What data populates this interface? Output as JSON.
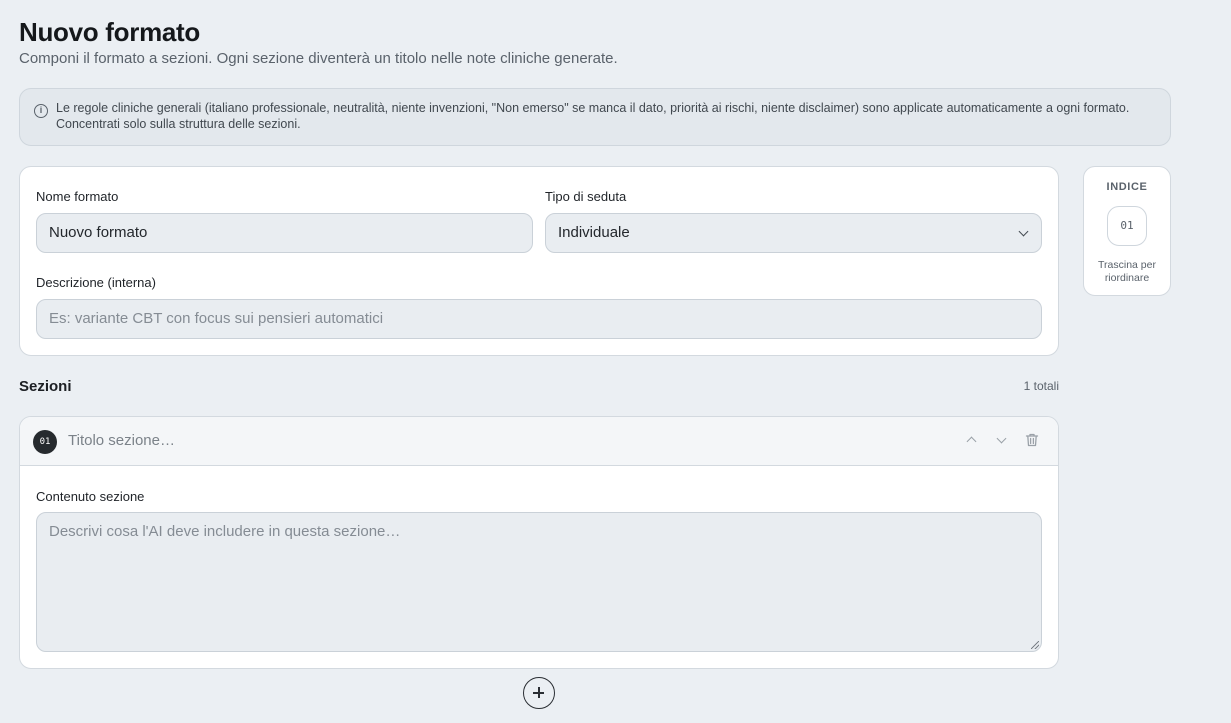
{
  "header": {
    "title": "Nuovo formato",
    "subtitle": "Componi il formato a sezioni. Ogni sezione diventerà un titolo nelle note cliniche generate."
  },
  "info": {
    "icon": "info-icon",
    "line1": "Le regole cliniche generali (italiano professionale, neutralità, niente invenzioni, \"Non emerso\" se manca il dato, priorità ai rischi, niente disclaimer) sono applicate automaticamente a ogni formato.",
    "line2": "Concentrati solo sulla struttura delle sezioni."
  },
  "form": {
    "name_label": "Nome formato",
    "name_value": "Nuovo formato",
    "session_label": "Tipo di seduta",
    "session_value": "Individuale",
    "description_label": "Descrizione (interna)",
    "description_placeholder": "Es: variante CBT con focus sui pensieri automatici"
  },
  "index": {
    "title": "INDICE",
    "item": "01",
    "hint": "Trascina per riordinare"
  },
  "sections": {
    "heading": "Sezioni",
    "count": "1 totali",
    "items": [
      {
        "number": "01",
        "title_placeholder": "Titolo sezione…",
        "content_label": "Contenuto sezione",
        "content_placeholder": "Descrivi cosa l'AI deve includere in questa sezione…"
      }
    ]
  },
  "colors": {
    "background": "#ebeff3",
    "card": "#ffffff",
    "accent_dark": "#262a2e"
  }
}
